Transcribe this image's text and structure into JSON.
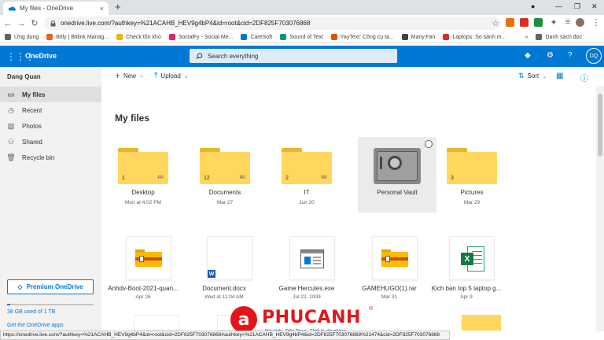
{
  "browser": {
    "tab_title": "My files - OneDrive",
    "tab_close": "×",
    "new_tab": "+",
    "url": "onedrive.live.com/?authkey=%21ACAHB_HEV9g4bP4&id=root&cid=2DF825F703076868",
    "back": "←",
    "forward": "→",
    "reload": "↻",
    "bookmarks": [
      {
        "label": "Ứng dụng",
        "color": "#5f6368"
      },
      {
        "label": "Bitly | Bitlink Manag...",
        "color": "#ee6123"
      },
      {
        "label": "Check tồn kho",
        "color": "#f4b400"
      },
      {
        "label": "SocialFy - Social Me...",
        "color": "#e91e63"
      },
      {
        "label": "CareSoft",
        "color": "#0078d4"
      },
      {
        "label": "Sound of Text",
        "color": "#009688"
      },
      {
        "label": "YayText: Công cụ tạ...",
        "color": "#e65100"
      },
      {
        "label": "Many.Fan",
        "color": "#424242"
      },
      {
        "label": "Laptops: So sánh m...",
        "color": "#d32f2f"
      }
    ],
    "bookmarks_overflow": "»",
    "reading_list": "Danh sách đọc"
  },
  "header": {
    "app_name": "OneDrive",
    "search_placeholder": "Search everything",
    "avatar_initials": "DQ",
    "brand_color": "#0078d4"
  },
  "sidebar": {
    "user_name": "Dang Quan",
    "items": [
      {
        "label": "My files",
        "icon": "folder-icon",
        "glyph": "▭",
        "active": true
      },
      {
        "label": "Recent",
        "icon": "clock-icon",
        "glyph": "◷",
        "active": false
      },
      {
        "label": "Photos",
        "icon": "image-icon",
        "glyph": "▨",
        "active": false
      },
      {
        "label": "Shared",
        "icon": "people-icon",
        "glyph": "⚇",
        "active": false
      },
      {
        "label": "Recycle bin",
        "icon": "trash-icon",
        "glyph": "🗑",
        "active": false
      }
    ],
    "premium_label": "Premium OneDrive",
    "quota_text": "38 GB used of 1 TB",
    "quota_fraction": 0.038,
    "get_apps": "Get the OneDrive apps"
  },
  "commands": {
    "new_label": "New",
    "upload_label": "Upload",
    "sort_label": "Sort"
  },
  "page_title": "My files",
  "folders": [
    {
      "name": "Desktop",
      "meta": "Mon at 4:02 PM",
      "count": "1",
      "shared": true
    },
    {
      "name": "Documents",
      "meta": "Mar 27",
      "count": "12",
      "shared": true
    },
    {
      "name": "IT",
      "meta": "Jun 20",
      "count": "2",
      "shared": true
    },
    {
      "name": "Personal Vault",
      "meta": "",
      "count": "",
      "shared": false,
      "vault": true
    },
    {
      "name": "Pictures",
      "meta": "Mar 29",
      "count": "3",
      "shared": false
    }
  ],
  "files": [
    {
      "name": "Anhdv-Boot-2021-quan...",
      "meta": "Apr 26",
      "type": "zip",
      "shared": true
    },
    {
      "name": "Document.docx",
      "meta": "Wed at 11:04 AM",
      "type": "docx",
      "shared": false
    },
    {
      "name": "Game Hercules.exe",
      "meta": "Jul 22, 2009",
      "type": "exe",
      "shared": true
    },
    {
      "name": "GAMEHUGO(1).rar",
      "meta": "Mar 31",
      "type": "zip",
      "shared": true
    },
    {
      "name": "Kich ban top 5 laptop g...",
      "meta": "Apr 9",
      "type": "xlsx",
      "shared": false
    }
  ],
  "watermark": {
    "brand": "PHUCANH",
    "letter": "a",
    "registered": "®",
    "tagline": "Máy tính - Điện Thoại - Thiết bị văn phòng"
  },
  "status_url": "https://onedrive.live.com/?authkey=%21ACAHB_HEV9g4bP4&id=root&cid=2DF825F703076868#authkey=%21ACAHB_HEV9g4bP4&id=2DF825F703076868%21474&cid=2DF825F703076868"
}
